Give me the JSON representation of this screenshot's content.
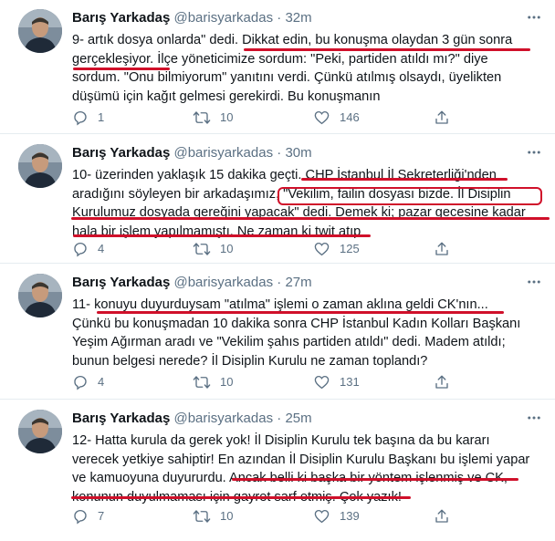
{
  "tweets": [
    {
      "name": "Barış Yarkadaş",
      "handle": "@barisyarkadas",
      "dot": "·",
      "time": "32m",
      "lines": [
        "9- artık dosya onlarda\" dedi. Dikkat edin, bu konuşma olaydan 3 gün sonra",
        "gerçekleşiyor. İlçe yöneticimize sordum: \"Peki, partiden atıldı mı?\" diye",
        "sordum. \"Onu bilmiyorum\" yanıtını verdi. Çünkü atılmış olsaydı, üyelikten",
        "düşümü için kağıt gelmesi gerekirdi. Bu konuşmanın"
      ],
      "replies": "1",
      "retweets": "10",
      "likes": "146"
    },
    {
      "name": "Barış Yarkadaş",
      "handle": "@barisyarkadas",
      "dot": "·",
      "time": "30m",
      "lines": [
        "10- üzerinden yaklaşık 15 dakika geçti. CHP İstanbul İl Sekreterliği'nden",
        "aradığını söyleyen bir arkadaşımız, \"Vekilim, failin dosyası bizde. İl Disiplin",
        "Kurulumuz dosyada gereğini yapacak\" dedi. Demek ki; pazar gecesine kadar",
        "hala bir işlem yapılmamıştı. Ne zaman ki twit atıp"
      ],
      "replies": "4",
      "retweets": "10",
      "likes": "125"
    },
    {
      "name": "Barış Yarkadaş",
      "handle": "@barisyarkadas",
      "dot": "·",
      "time": "27m",
      "lines": [
        "11- konuyu duyurduysam \"atılma\" işlemi o zaman aklına geldi CK'nın...",
        "Çünkü bu konuşmadan 10 dakika sonra CHP İstanbul Kadın Kolları Başkanı",
        "Yeşim Ağırman aradı ve \"Vekilim şahıs partiden atıldı\" dedi. Madem atıldı;",
        "bunun belgesi nerede? İl Disiplin Kurulu ne zaman toplandı?"
      ],
      "replies": "4",
      "retweets": "10",
      "likes": "131"
    },
    {
      "name": "Barış Yarkadaş",
      "handle": "@barisyarkadas",
      "dot": "·",
      "time": "25m",
      "lines": [
        "12- Hatta kurula da gerek yok! İl Disiplin Kurulu tek başına da bu kararı",
        "verecek yetkiye sahiptir! En azından İl Disiplin Kurulu Başkanı bu işlemi yapar",
        "ve kamuoyuna duyururdu. Ancak belli ki başka bir yöntem işlenmiş ve CK,",
        "konunun duyulmaması için gayret sarf etmiş. Çok yazık!"
      ],
      "replies": "7",
      "retweets": "10",
      "likes": "139"
    }
  ],
  "colors": {
    "underline": "#d0102a",
    "secondary_text": "#5b7083",
    "divider": "#e6ecf0"
  },
  "icons": [
    "more-icon",
    "reply-icon",
    "retweet-icon",
    "like-icon",
    "share-icon"
  ]
}
